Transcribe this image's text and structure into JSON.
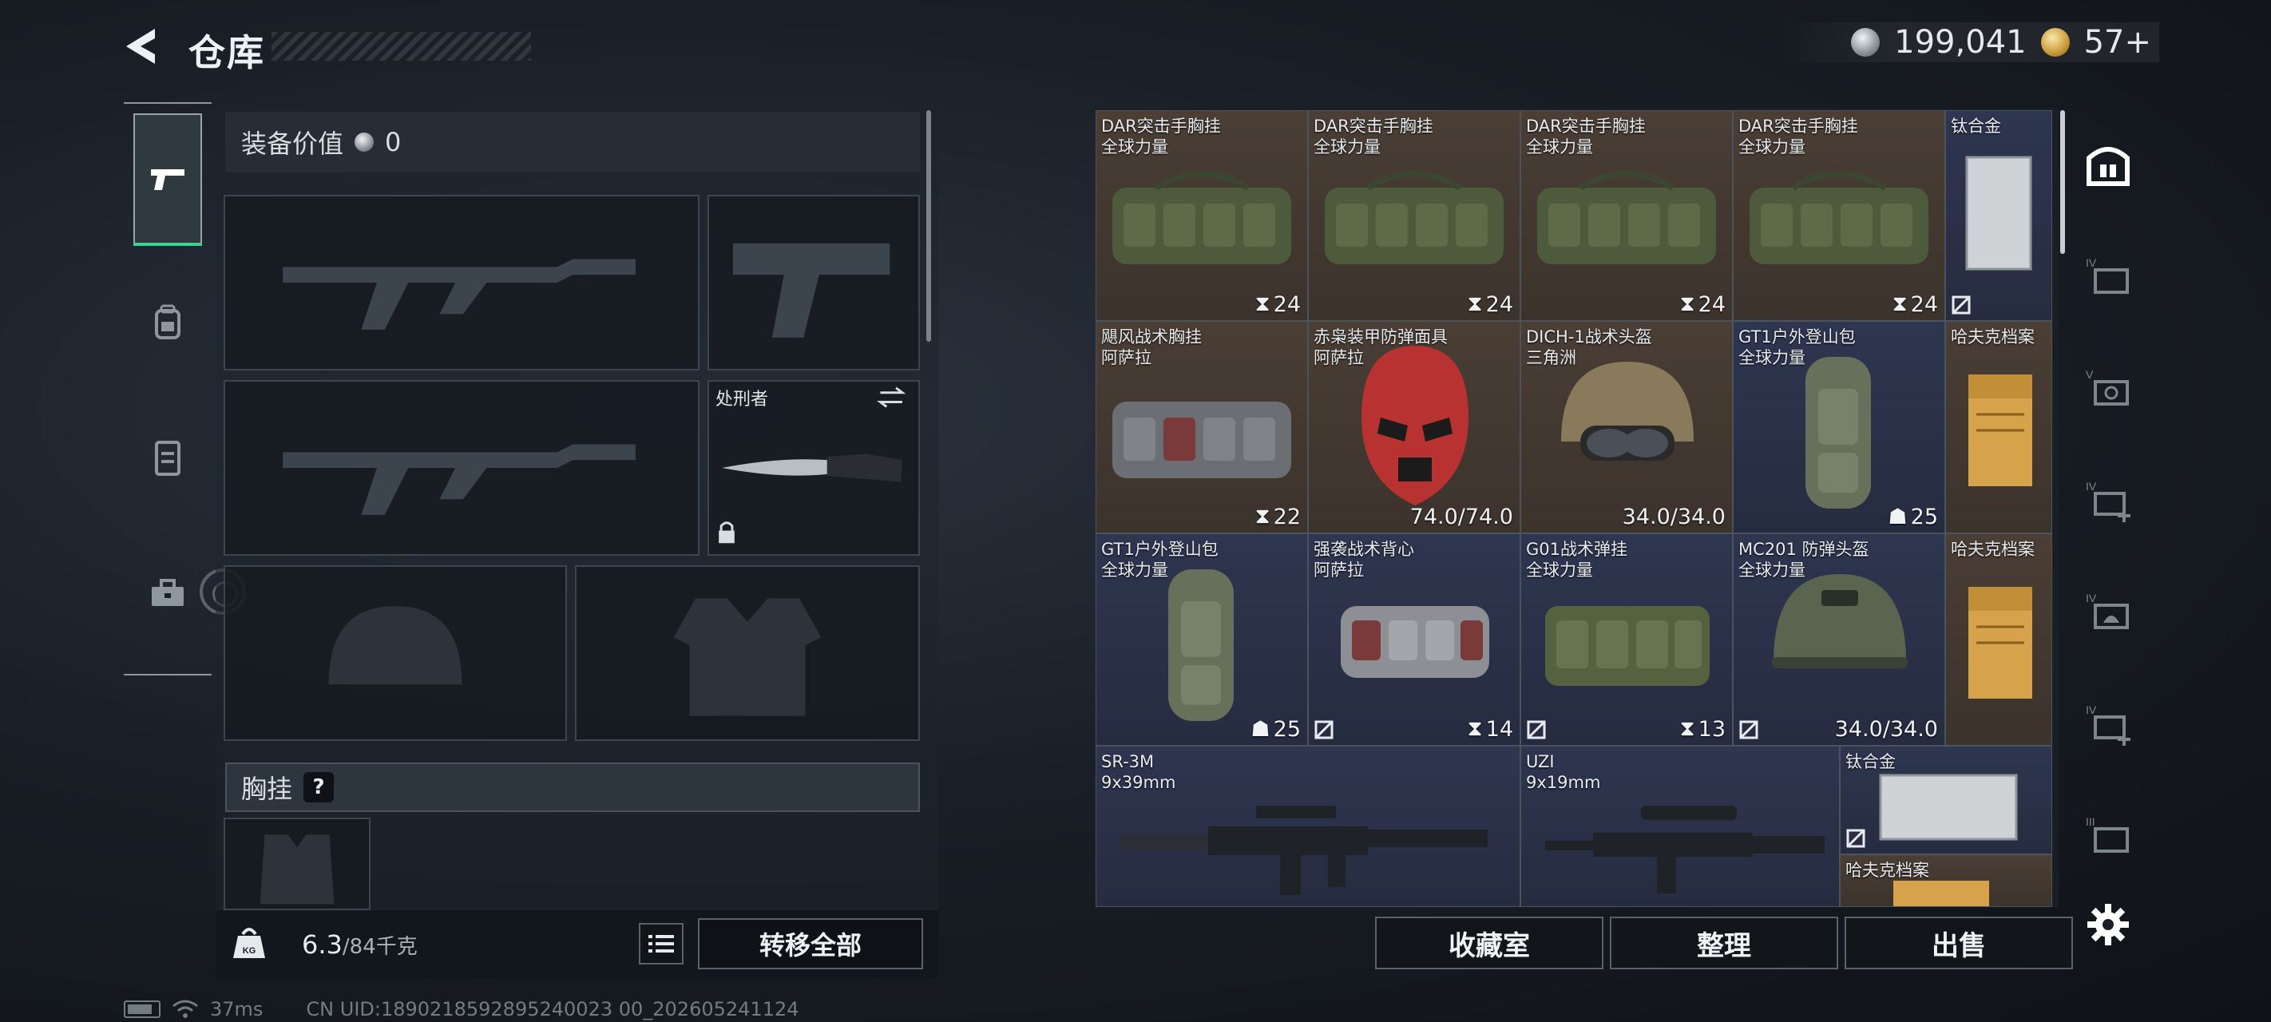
{
  "header": {
    "title": "仓库",
    "currency_silver": "199,041",
    "currency_gold": "57+"
  },
  "equipment": {
    "value_label": "装备价值",
    "value_amount": "0",
    "knife_name": "处刑者",
    "chest_rig_label": "胸挂",
    "help_symbol": "?"
  },
  "weight": {
    "current": "6.3",
    "max": "/84千克"
  },
  "buttons": {
    "transfer_all": "转移全部",
    "collection": "收藏室",
    "organize": "整理",
    "sell": "出售"
  },
  "status": {
    "ping": "37ms",
    "uid": "CN UID:1890218592895240023 00_202605241124"
  },
  "icons": {
    "back": "chevron-left-icon",
    "nav": [
      "pistol-icon",
      "backpack-icon",
      "vest-icon",
      "toolbox-icon"
    ],
    "right_tools": [
      "home-icon",
      "tier-iv-case-icon",
      "tier-v-case-icon",
      "tier-iv-add-icon",
      "tier-iv-helmet-icon",
      "tier-iv-plus-icon",
      "tier-iii-case-icon"
    ],
    "settings": "gear-icon"
  },
  "warehouse": {
    "items": [
      {
        "name": "DAR突击手胸挂",
        "sub": "全球力量",
        "count": "24",
        "tone": "brown"
      },
      {
        "name": "DAR突击手胸挂",
        "sub": "全球力量",
        "count": "24",
        "tone": "brown"
      },
      {
        "name": "DAR突击手胸挂",
        "sub": "全球力量",
        "count": "24",
        "tone": "brown"
      },
      {
        "name": "DAR突击手胸挂",
        "sub": "全球力量",
        "count": "24",
        "tone": "brown"
      },
      {
        "name": "钛合金",
        "sub": "",
        "count": "",
        "tone": "blue"
      },
      {
        "name": "飓风战术胸挂",
        "sub": "阿萨拉",
        "count": "22",
        "tone": "brown"
      },
      {
        "name": "赤枭装甲防弹面具",
        "sub": "阿萨拉",
        "count": "74.0/74.0",
        "tone": "brown"
      },
      {
        "name": "DICH-1战术头盔",
        "sub": "三角洲",
        "count": "34.0/34.0",
        "tone": "brown"
      },
      {
        "name": "GT1户外登山包",
        "sub": "全球力量",
        "count": "25",
        "tone": "blue"
      },
      {
        "name": "哈夫克档案",
        "sub": "",
        "count": "",
        "tone": "brown"
      },
      {
        "name": "GT1户外登山包",
        "sub": "全球力量",
        "count": "25",
        "tone": "blue"
      },
      {
        "name": "强袭战术背心",
        "sub": "阿萨拉",
        "count": "14",
        "tone": "blue"
      },
      {
        "name": "G01战术弹挂",
        "sub": "全球力量",
        "count": "13",
        "tone": "blue"
      },
      {
        "name": "MC201 防弹头盔",
        "sub": "全球力量",
        "count": "34.0/34.0",
        "tone": "blue"
      },
      {
        "name": "哈夫克档案",
        "sub": "",
        "count": "",
        "tone": "brown"
      },
      {
        "name": "SR-3M",
        "sub": "9x39mm",
        "count": "",
        "tone": "blue"
      },
      {
        "name": "UZI",
        "sub": "9x19mm",
        "count": "",
        "tone": "blue"
      },
      {
        "name": "钛合金",
        "sub": "",
        "count": "",
        "tone": "blue"
      },
      {
        "name": "哈夫克档案",
        "sub": "",
        "count": "",
        "tone": "brown"
      }
    ]
  }
}
